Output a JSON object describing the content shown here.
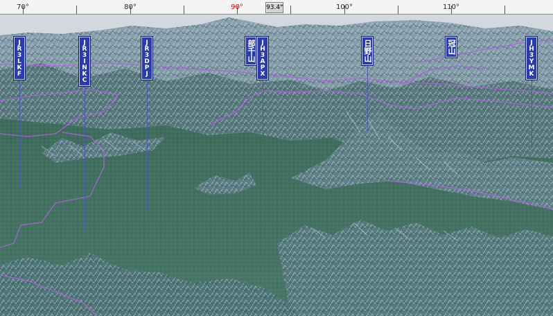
{
  "compass": {
    "heading": "93.4°",
    "ticks": [
      {
        "label": "70°",
        "red": false
      },
      {
        "label": "80°",
        "red": false
      },
      {
        "label": "90°",
        "red": true
      },
      {
        "label": "100°",
        "red": false
      },
      {
        "label": "110°",
        "red": false
      }
    ]
  },
  "peaks": [
    {
      "label": "JR3LKF"
    },
    {
      "label": "JR3INKC"
    },
    {
      "label": "JR3DPJ"
    },
    {
      "label": "部千山"
    },
    {
      "label": "JH3APX"
    },
    {
      "label": "日野山"
    },
    {
      "label": "冠山"
    },
    {
      "label": "JH3YMK"
    }
  ],
  "colors": {
    "sky": "#bfc6cf",
    "plain": "#3d6a5c",
    "mountain": "#5c7f86",
    "snow": "#c9d6de",
    "boundary": "#b060e0",
    "marker": "#2a3ca8"
  }
}
